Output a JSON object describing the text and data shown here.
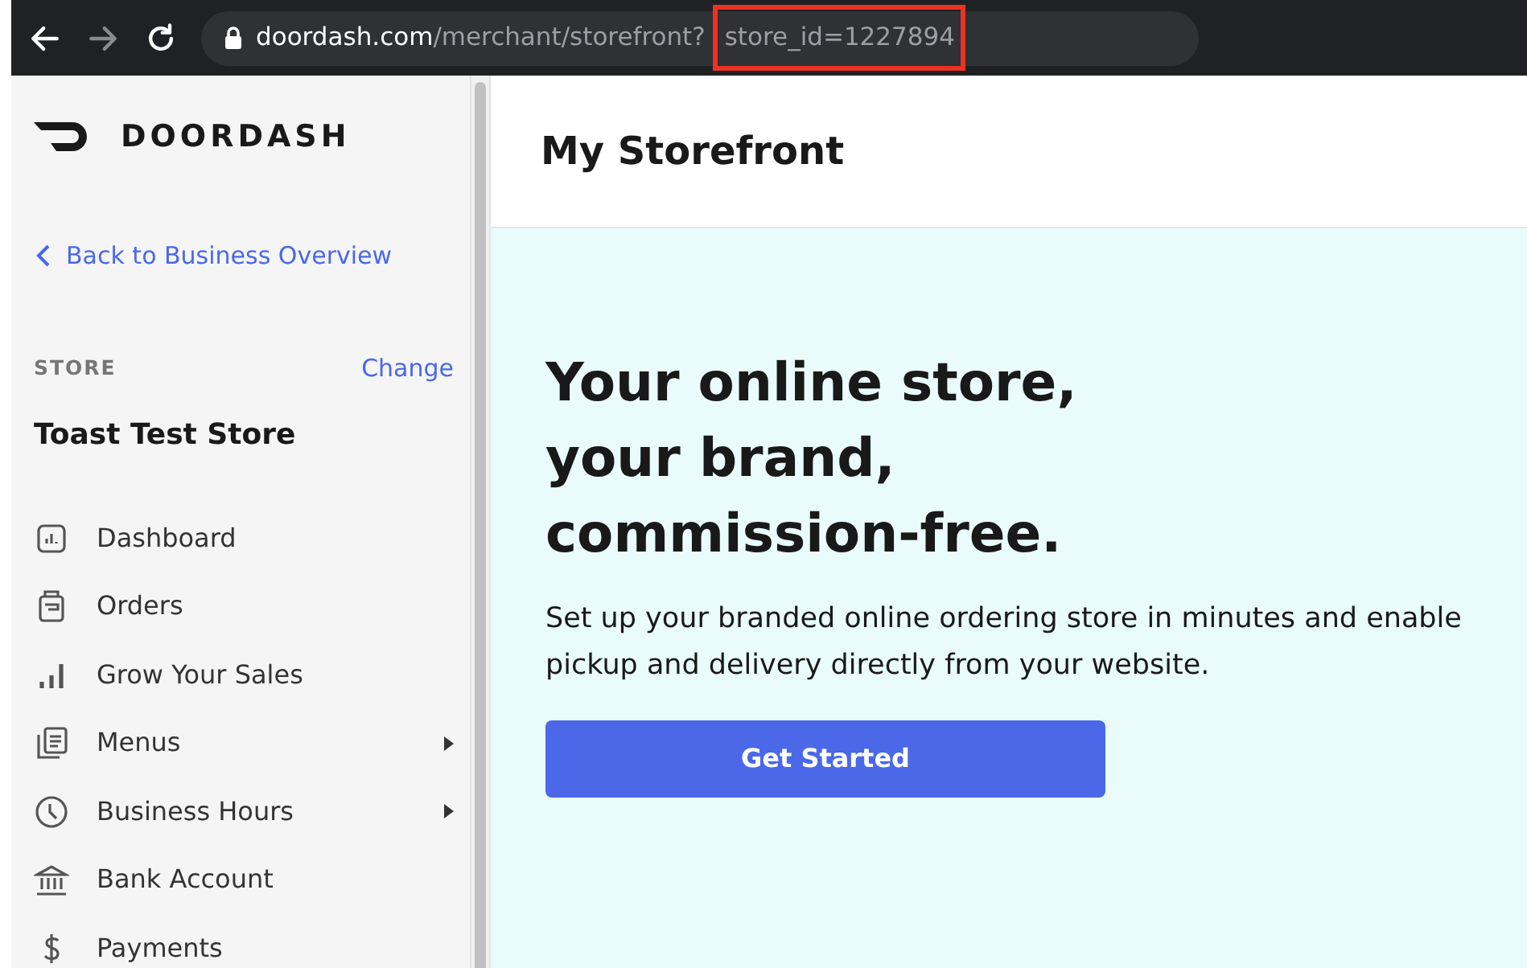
{
  "browser": {
    "url_host": "doordash.com",
    "url_path": "/merchant/storefront?",
    "url_query": "store_id=1227894",
    "query_highlighted": true
  },
  "sidebar": {
    "logo": "DOORDASH",
    "back_link": "Back to Business Overview",
    "store_label": "STORE",
    "change_link": "Change",
    "store_name": "Toast Test Store",
    "items": [
      {
        "label": "Dashboard",
        "has_submenu": false
      },
      {
        "label": "Orders",
        "has_submenu": false
      },
      {
        "label": "Grow Your Sales",
        "has_submenu": false
      },
      {
        "label": "Menus",
        "has_submenu": true
      },
      {
        "label": "Business Hours",
        "has_submenu": true
      },
      {
        "label": "Bank Account",
        "has_submenu": false
      },
      {
        "label": "Payments",
        "has_submenu": false
      }
    ]
  },
  "page": {
    "title": "My Storefront",
    "hero_heading": [
      "Your online store,",
      "your brand,",
      "commission-free."
    ],
    "hero_text": "Set up your branded online ordering store in minutes and enable pickup and delivery directly from your website.",
    "cta_button": "Get Started"
  }
}
